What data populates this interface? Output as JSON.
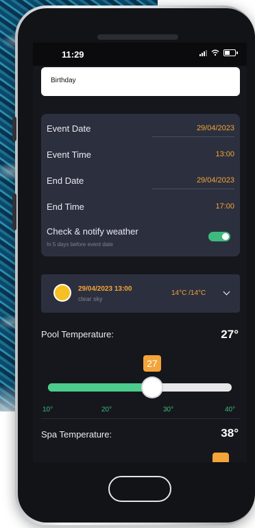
{
  "status_bar": {
    "time": "11:29"
  },
  "event": {
    "name_value": "Birthday",
    "details": [
      {
        "label": "Event Date",
        "value": "29/04/2023"
      },
      {
        "label": "Event Time",
        "value": "13:00"
      },
      {
        "label": "End Date",
        "value": "29/04/2023"
      },
      {
        "label": "End Time",
        "value": "17:00"
      }
    ],
    "notify": {
      "label": "Check & notify weather",
      "sublabel": "In 5 days before event date",
      "enabled": true
    }
  },
  "weather": {
    "datetime": "29/04/2023 13:00",
    "description": "clear sky",
    "temps": "14°C /14°C"
  },
  "pool": {
    "label": "Pool Temperature:",
    "value": "27°",
    "slider_value": "27",
    "slider_level": 27,
    "min": 10,
    "max": 40,
    "ticks": [
      "10°",
      "20°",
      "30°",
      "40°"
    ]
  },
  "spa": {
    "label": "Spa Temperature:",
    "value": "38°"
  },
  "colors": {
    "accent": "#f5a43a",
    "toggle_on": "#3fba7f",
    "slider_fill": "#4ccc8c",
    "card": "#2c303e",
    "screen": "#16171c"
  }
}
